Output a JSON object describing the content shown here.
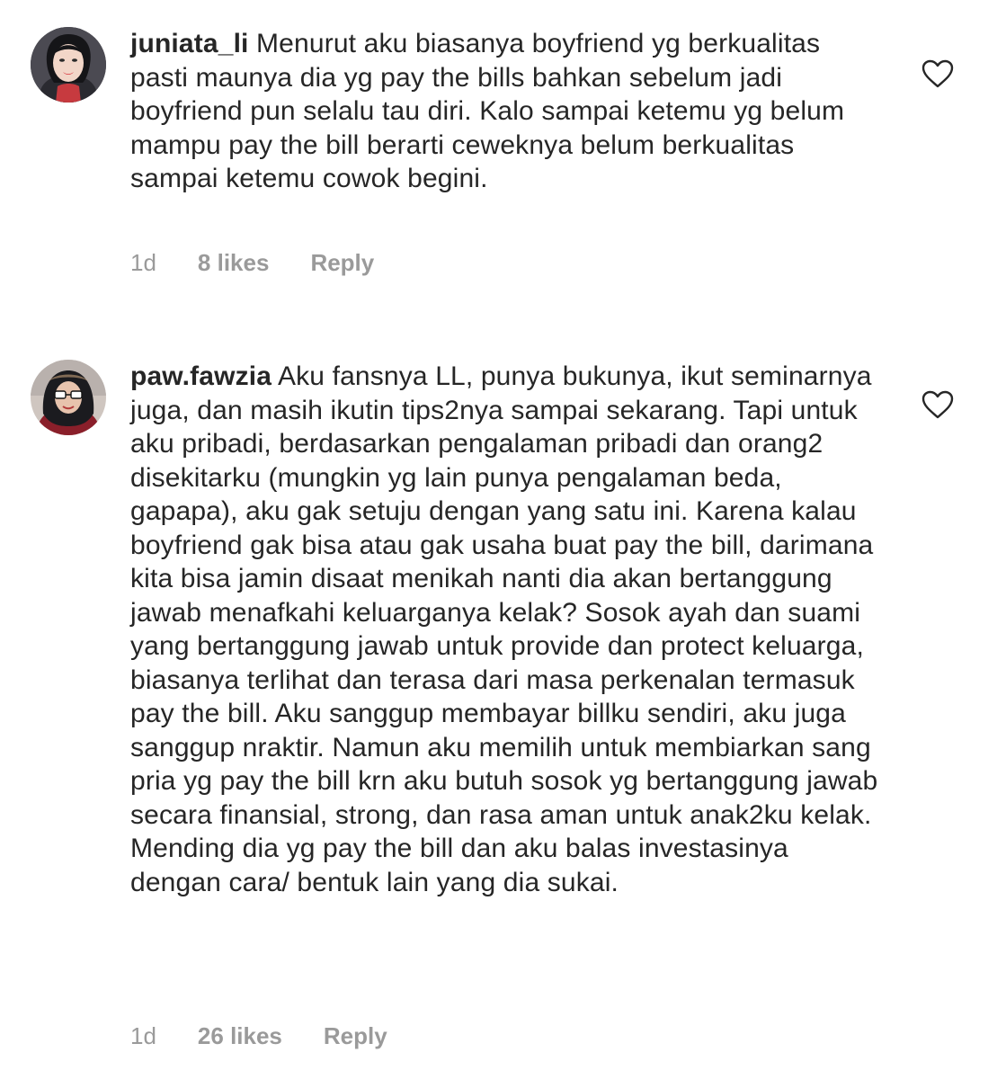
{
  "comments": [
    {
      "username": "juniata_li",
      "text": "Menurut aku biasanya boyfriend yg berkualitas pasti maunya dia yg pay the bills bahkan sebelum jadi boyfriend pun selalu tau diri. Kalo sampai ketemu yg belum mampu pay the bill berarti ceweknya belum berkualitas sampai ketemu cowok begini.",
      "time": "1d",
      "likes": "8 likes",
      "reply_label": "Reply",
      "avatar_icon": "profile-avatar-woman-red-lips",
      "like_icon": "heart-outline-icon"
    },
    {
      "username": "paw.fawzia",
      "text": "Aku fansnya LL, punya bukunya, ikut seminarnya juga, dan masih ikutin tips2nya sampai sekarang. Tapi untuk aku pribadi, berdasarkan pengalaman pribadi dan orang2 disekitarku (mungkin yg lain punya pengalaman beda, gapapa), aku gak setuju dengan yang satu ini. Karena kalau boyfriend gak bisa atau gak usaha buat pay the bill, darimana kita bisa jamin disaat menikah nanti dia akan bertanggung jawab menafkahi keluarganya kelak? Sosok ayah dan suami yang bertanggung jawab untuk provide dan protect keluarga, biasanya terlihat dan terasa dari masa perkenalan termasuk pay the bill. Aku sanggup membayar billku sendiri, aku juga sanggup nraktir. Namun aku memilih untuk membiarkan sang pria yg pay the bill krn aku butuh sosok yg bertanggung jawab secara finansial, strong, dan rasa aman untuk anak2ku kelak. Mending dia yg pay the bill dan aku balas investasinya dengan cara/ bentuk lain yang dia sukai.",
      "time": "1d",
      "likes": "26 likes",
      "reply_label": "Reply",
      "avatar_icon": "profile-avatar-woman-hijab-glasses",
      "like_icon": "heart-outline-icon"
    }
  ],
  "colors": {
    "text": "#262626",
    "meta": "#9a9a9a",
    "heart": "#262626"
  }
}
